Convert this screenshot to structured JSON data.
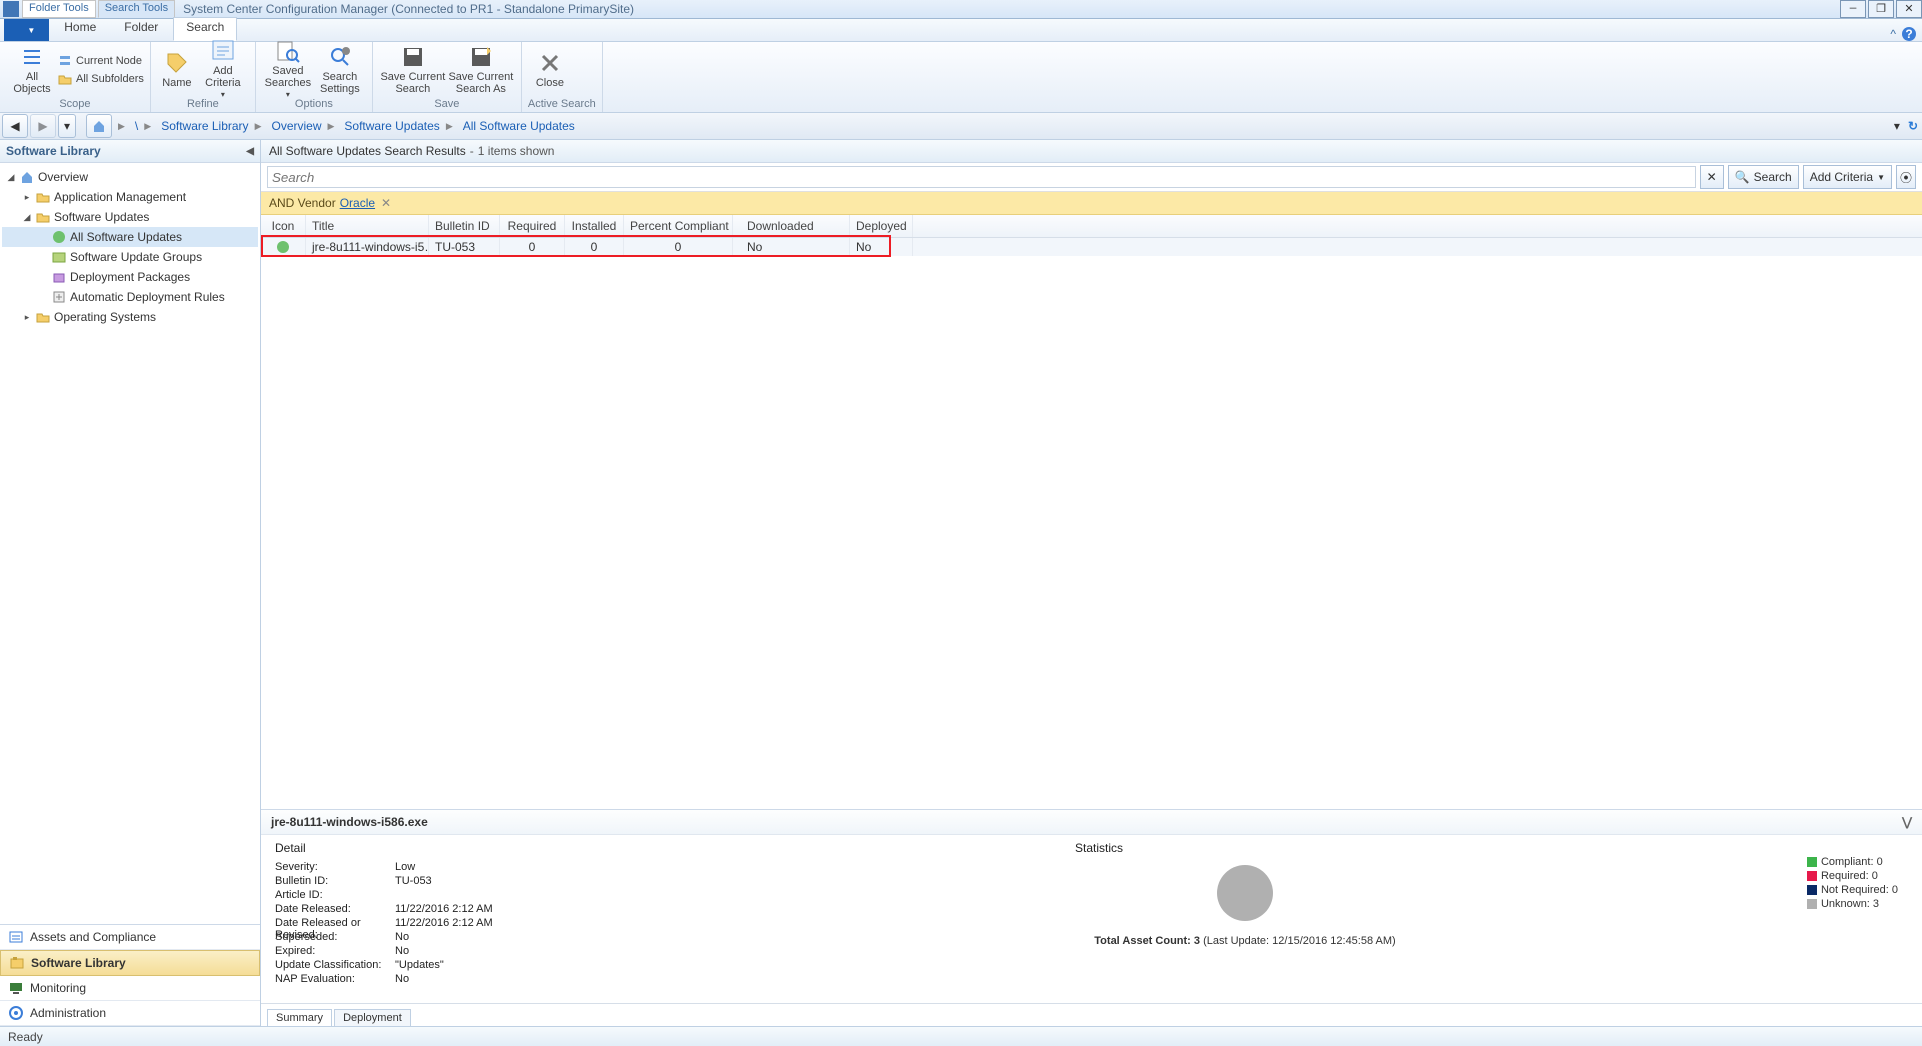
{
  "window": {
    "context_tabs": [
      "Folder Tools",
      "Search Tools"
    ],
    "active_context": 1,
    "title": "System Center Configuration Manager (Connected to PR1 - Standalone PrimarySite)"
  },
  "ribbon_tabs": {
    "file": "",
    "tabs": [
      "Home",
      "Folder",
      "Search"
    ],
    "active": 2
  },
  "ribbon": {
    "all_objects": "All\nObjects",
    "current_node": "Current Node",
    "all_subfolders": "All Subfolders",
    "scope_group": "Scope",
    "name": "Name",
    "add_criteria": "Add\nCriteria",
    "refine_group": "Refine",
    "saved_searches": "Saved\nSearches",
    "search_settings": "Search\nSettings",
    "options_group": "Options",
    "save_current_search": "Save Current\nSearch",
    "save_current_search_as": "Save Current\nSearch As",
    "save_group": "Save",
    "close": "Close",
    "active_search_group": "Active Search"
  },
  "breadcrumb": [
    "\\",
    "Software Library",
    "Overview",
    "Software Updates",
    "All Software Updates"
  ],
  "left_title": "Software Library",
  "tree": [
    {
      "ind": 0,
      "tog": "◢",
      "icon": "home",
      "label": "Overview"
    },
    {
      "ind": 1,
      "tog": "▸",
      "icon": "folder",
      "label": "Application Management"
    },
    {
      "ind": 1,
      "tog": "◢",
      "icon": "folder",
      "label": "Software Updates"
    },
    {
      "ind": 2,
      "tog": "",
      "icon": "update",
      "label": "All Software Updates",
      "selected": true
    },
    {
      "ind": 2,
      "tog": "",
      "icon": "group",
      "label": "Software Update Groups"
    },
    {
      "ind": 2,
      "tog": "",
      "icon": "pkg",
      "label": "Deployment Packages"
    },
    {
      "ind": 2,
      "tog": "",
      "icon": "auto",
      "label": "Automatic Deployment Rules"
    },
    {
      "ind": 1,
      "tog": "▸",
      "icon": "folder",
      "label": "Operating Systems"
    }
  ],
  "workspace": [
    {
      "label": "Assets and Compliance",
      "icon": "assets"
    },
    {
      "label": "Software Library",
      "icon": "swlib",
      "active": true
    },
    {
      "label": "Monitoring",
      "icon": "monitor"
    },
    {
      "label": "Administration",
      "icon": "admin"
    }
  ],
  "results_header": {
    "title": "All Software Updates Search Results",
    "count": "1 items shown"
  },
  "search": {
    "placeholder": "Search",
    "btn": "Search",
    "add_criteria": "Add Criteria",
    "clear": "✕"
  },
  "criteria": {
    "prefix": "AND Vendor",
    "value": "Oracle"
  },
  "columns": [
    "Icon",
    "Title",
    "Bulletin ID",
    "Required",
    "Installed",
    "Percent Compliant",
    "Downloaded",
    "Deployed"
  ],
  "rows": [
    {
      "title": "jre-8u111-windows-i5…",
      "bulletin": "TU-053",
      "required": "0",
      "installed": "0",
      "percent": "0",
      "downloaded": "No",
      "deployed": "No"
    }
  ],
  "details": {
    "title": "jre-8u111-windows-i586.exe",
    "detail_heading": "Detail",
    "stats_heading": "Statistics",
    "fields": [
      {
        "k": "Severity:",
        "v": "Low"
      },
      {
        "k": "Bulletin ID:",
        "v": "TU-053"
      },
      {
        "k": "Article ID:",
        "v": ""
      },
      {
        "k": "Date Released:",
        "v": "11/22/2016 2:12 AM"
      },
      {
        "k": "Date Released or Revised:",
        "v": "11/22/2016 2:12 AM"
      },
      {
        "k": "Superseded:",
        "v": "No"
      },
      {
        "k": "Expired:",
        "v": "No"
      },
      {
        "k": "Update Classification:",
        "v": "\"Updates\""
      },
      {
        "k": "NAP Evaluation:",
        "v": "No"
      }
    ],
    "total_asset": "Total Asset Count: 3",
    "total_asset_after": " (Last Update: 12/15/2016 12:45:58 AM)",
    "legend": [
      {
        "c": "#3cb44b",
        "t": "Compliant: 0"
      },
      {
        "c": "#e6194b",
        "t": "Required: 0"
      },
      {
        "c": "#0a2a66",
        "t": "Not Required: 0"
      },
      {
        "c": "#b0b0b0",
        "t": "Unknown: 3"
      }
    ],
    "tabs": [
      "Summary",
      "Deployment"
    ],
    "active_tab": 0
  },
  "status": "Ready"
}
